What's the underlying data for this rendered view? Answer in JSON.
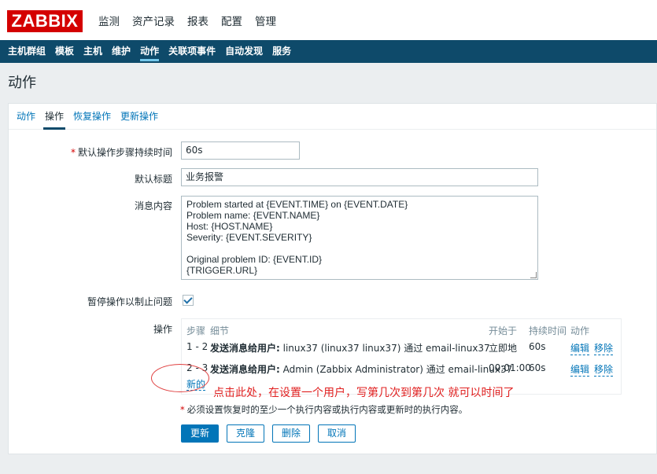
{
  "logo": "ZABBIX",
  "top_menu": [
    "监测",
    "资产记录",
    "报表",
    "配置",
    "管理"
  ],
  "sub_nav": [
    "主机群组",
    "模板",
    "主机",
    "维护",
    "动作",
    "关联项事件",
    "自动发现",
    "服务"
  ],
  "page_title": "动作",
  "tabs": [
    "动作",
    "操作",
    "恢复操作",
    "更新操作"
  ],
  "form": {
    "duration_label": "默认操作步骤持续时间",
    "duration_value": "60s",
    "subject_label": "默认标题",
    "subject_value": "业务报警",
    "message_label": "消息内容",
    "message_value": "Problem started at {EVENT.TIME} on {EVENT.DATE}\nProblem name: {EVENT.NAME}\nHost: {HOST.NAME}\nSeverity: {EVENT.SEVERITY}\n\nOriginal problem ID: {EVENT.ID}\n{TRIGGER.URL}",
    "pause_label": "暂停操作以制止问题",
    "pause_checked": true,
    "operations_label": "操作"
  },
  "operations": {
    "headers": {
      "steps": "步骤",
      "details": "细节",
      "start_in": "开始于",
      "duration": "持续时间",
      "action": "动作"
    },
    "rows": [
      {
        "steps": "1 - 2",
        "action_bold": "发送消息给用户:",
        "detail": "linux37 (linux37 linux37) 通过 email-linux37",
        "start_in": "立即地",
        "duration": "60s",
        "edit": "编辑",
        "remove": "移除"
      },
      {
        "steps": "2 - 3",
        "action_bold": "发送消息给用户:",
        "detail": "Admin (Zabbix Administrator) 通过 email-linux37",
        "start_in": "00:01:00",
        "duration": "60s",
        "edit": "编辑",
        "remove": "移除"
      }
    ],
    "new_link": "新的"
  },
  "annotation_text": "点击此处，在设置一个用户，写第几次到第几次    就可以时间了",
  "footnote": "必须设置恢复时的至少一个执行内容或执行内容或更新时的执行内容。",
  "footnote_star": "*",
  "buttons": {
    "update": "更新",
    "clone": "克隆",
    "delete": "删除",
    "cancel": "取消"
  },
  "colors": {
    "brand": "#d40000",
    "nav": "#0e4a6a",
    "link": "#0275b8",
    "annotation": "#e02020"
  }
}
